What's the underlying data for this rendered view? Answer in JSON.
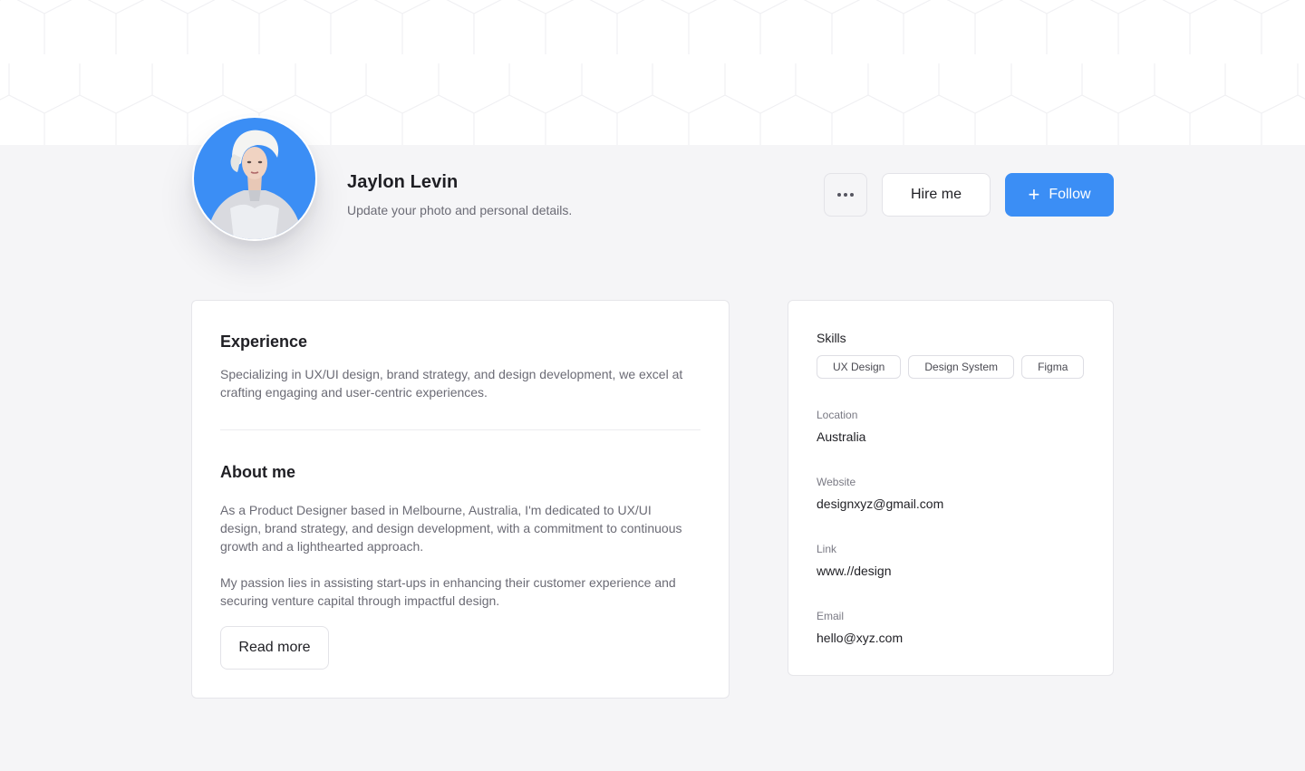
{
  "profile": {
    "name": "Jaylon Levin",
    "subtitle": "Update your photo and personal details."
  },
  "actions": {
    "more_icon": "more-horizontal-icon",
    "hire_label": "Hire me",
    "follow_label": "Follow",
    "follow_icon": "plus-icon"
  },
  "experience": {
    "heading": "Experience",
    "text": "Specializing in UX/UI design, brand strategy, and design development, we excel at crafting engaging and user-centric experiences."
  },
  "about": {
    "heading": "About me",
    "paragraph1": "As a Product Designer based in Melbourne, Australia, I'm dedicated to UX/UI design, brand strategy, and design development, with a commitment to continuous growth and a lighthearted approach.",
    "paragraph2": "My passion lies in assisting start-ups in enhancing their customer experience and securing venture capital through impactful design.",
    "read_more_label": "Read more"
  },
  "details": {
    "skills_label": "Skills",
    "skills": [
      "UX Design",
      "Design System",
      "Figma"
    ],
    "location_label": "Location",
    "location": "Australia",
    "website_label": "Website",
    "website": "designxyz@gmail.com",
    "link_label": "Link",
    "link": "www.//design",
    "email_label": "Email",
    "email": "hello@xyz.com"
  },
  "colors": {
    "accent": "#3b8ef5",
    "background": "#f5f5f7",
    "avatar_bg": "#3b8ef5"
  }
}
